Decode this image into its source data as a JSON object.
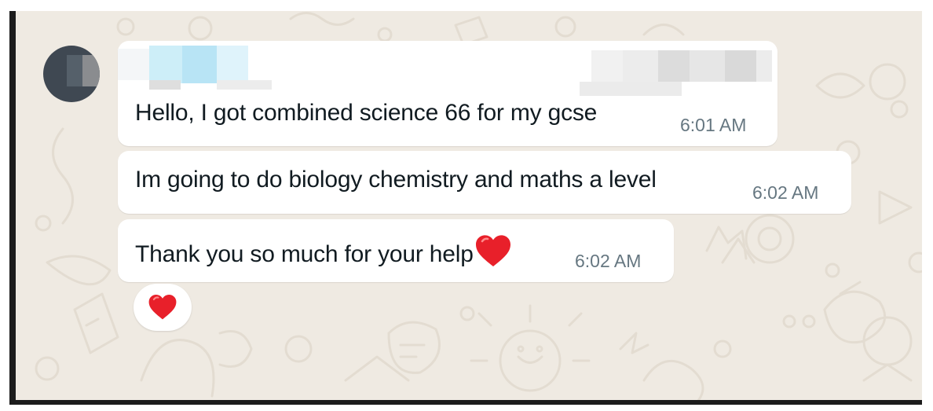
{
  "chat": {
    "sender_name": "",
    "messages": [
      {
        "text": "Hello, I got combined science 66 for my gcse",
        "time": "6:01 AM"
      },
      {
        "text": "Im going to do biology chemistry and maths a level",
        "time": "6:02 AM"
      },
      {
        "text": "Thank you so much for your help",
        "time": "6:02 AM",
        "emoji": "red-heart-icon"
      }
    ],
    "reaction": {
      "emoji": "red-heart-icon"
    }
  },
  "colors": {
    "chat_background": "#efeae2",
    "bubble": "#ffffff",
    "message_text": "#111b21",
    "timestamp": "#667781",
    "heart": "#e8202a",
    "frame": "#1c1c1c"
  }
}
